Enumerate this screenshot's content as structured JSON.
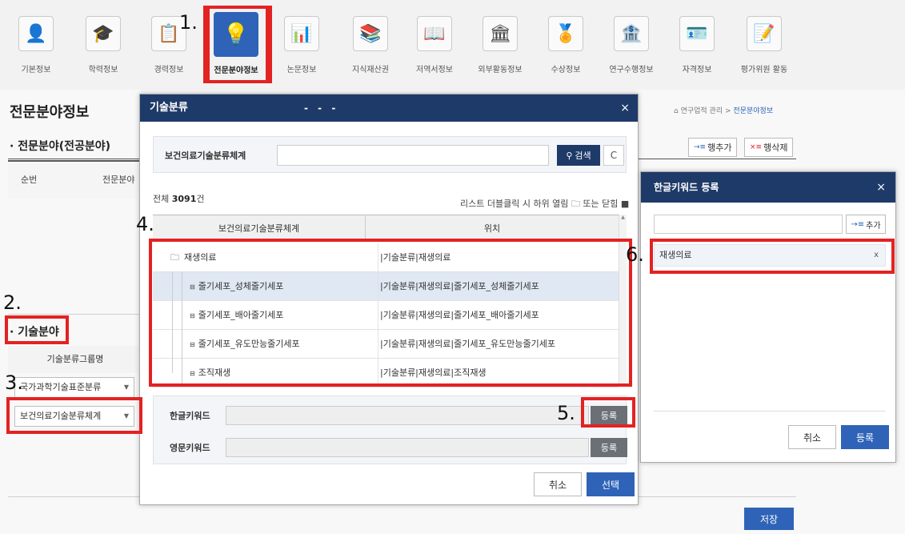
{
  "nav": {
    "items": [
      {
        "label": "기본정보",
        "icon": "👤"
      },
      {
        "label": "학력정보",
        "icon": "🎓"
      },
      {
        "label": "경력정보",
        "icon": "📋"
      },
      {
        "label": "전문분야정보",
        "icon": "💡"
      },
      {
        "label": "논문정보",
        "icon": "📊"
      },
      {
        "label": "지식재산권",
        "icon": "📚"
      },
      {
        "label": "저역서정보",
        "icon": "📖"
      },
      {
        "label": "외부활동정보",
        "icon": "🏛"
      },
      {
        "label": "수상정보",
        "icon": "🏅"
      },
      {
        "label": "연구수행정보",
        "icon": "🏦"
      },
      {
        "label": "자격정보",
        "icon": "🪪"
      },
      {
        "label": "평가위원 활동",
        "icon": "📝"
      }
    ],
    "active_index": 3
  },
  "page": {
    "title": "전문분야정보",
    "breadcrumb_home": "연구업적 관리",
    "breadcrumb_sep": ">",
    "breadcrumb_current": "전문분야정보",
    "section1": "전문분야(전공분야)",
    "add_row": "행추가",
    "del_row": "행삭제",
    "col_no": "순번",
    "col_field": "전문분야",
    "section2": "기술분야",
    "tech_group_header": "기술분류그룹명",
    "select1": "국가과학기술표준분류",
    "select2": "보건의료기술분류체계",
    "save": "저장"
  },
  "modal": {
    "title": "기술분류",
    "title_dots": "- - -",
    "close": "×",
    "search_label": "보건의료기술분류체계",
    "search_value": "",
    "search_button": "검색",
    "refresh": "C",
    "total_prefix": "전체",
    "total_count": "3091",
    "total_suffix": "건",
    "hint": "리스트 더블클릭 시 하위 열림 🗀 또는 닫힘 ■",
    "headers": [
      "보건의료기술분류체계",
      "위치"
    ],
    "rows": [
      {
        "name": "재생의료",
        "path": "|기술분류|재생의료"
      },
      {
        "name": "줄기세포_성체줄기세포",
        "path": "|기술분류|재생의료|줄기세포_성체줄기세포"
      },
      {
        "name": "줄기세포_배아줄기세포",
        "path": "|기술분류|재생의료|줄기세포_배아줄기세포"
      },
      {
        "name": "줄기세포_유도만능줄기세포",
        "path": "|기술분류|재생의료|줄기세포_유도만능줄기세포"
      },
      {
        "name": "조직재생",
        "path": "|기술분류|재생의료|조직재생"
      }
    ],
    "kor_keyword_label": "한글키워드",
    "eng_keyword_label": "영문키워드",
    "register": "등록",
    "cancel": "취소",
    "select": "선택"
  },
  "modal2": {
    "title": "한글키워드 등록",
    "close": "×",
    "input_value": "",
    "add_button": "추가",
    "keyword": "재생의료",
    "remove": "x",
    "cancel": "취소",
    "register": "등록"
  },
  "annotations": [
    "1.",
    "2.",
    "3.",
    "4.",
    "5.",
    "6."
  ],
  "colors": {
    "accent": "#2e63b8",
    "header": "#1e3a68",
    "annotation": "#e32222"
  }
}
